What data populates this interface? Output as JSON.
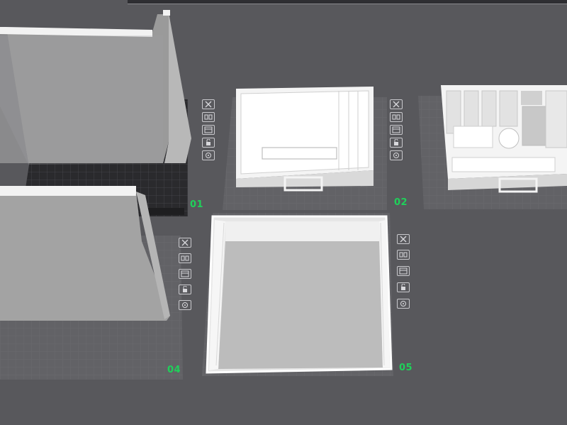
{
  "window": {
    "title": ""
  },
  "plates": [
    {
      "id": "01",
      "number": "01",
      "state": "active"
    },
    {
      "id": "02",
      "number": "02",
      "state": "inactive"
    },
    {
      "id": "03",
      "number": "",
      "state": "inactive"
    },
    {
      "id": "04",
      "number": "04",
      "state": "inactive"
    },
    {
      "id": "05",
      "number": "05",
      "state": "selected"
    }
  ],
  "plate_tools": [
    "close-icon",
    "auto-arrange-icon",
    "plate-settings-icon",
    "unlock-icon",
    "auto-orient-icon"
  ],
  "colors": {
    "background": "#58585c",
    "plate_label": "#1fd15a",
    "active_plate": "#2a2a2d",
    "model": "#e9e9e9",
    "selection_outline": "#ffffff"
  }
}
